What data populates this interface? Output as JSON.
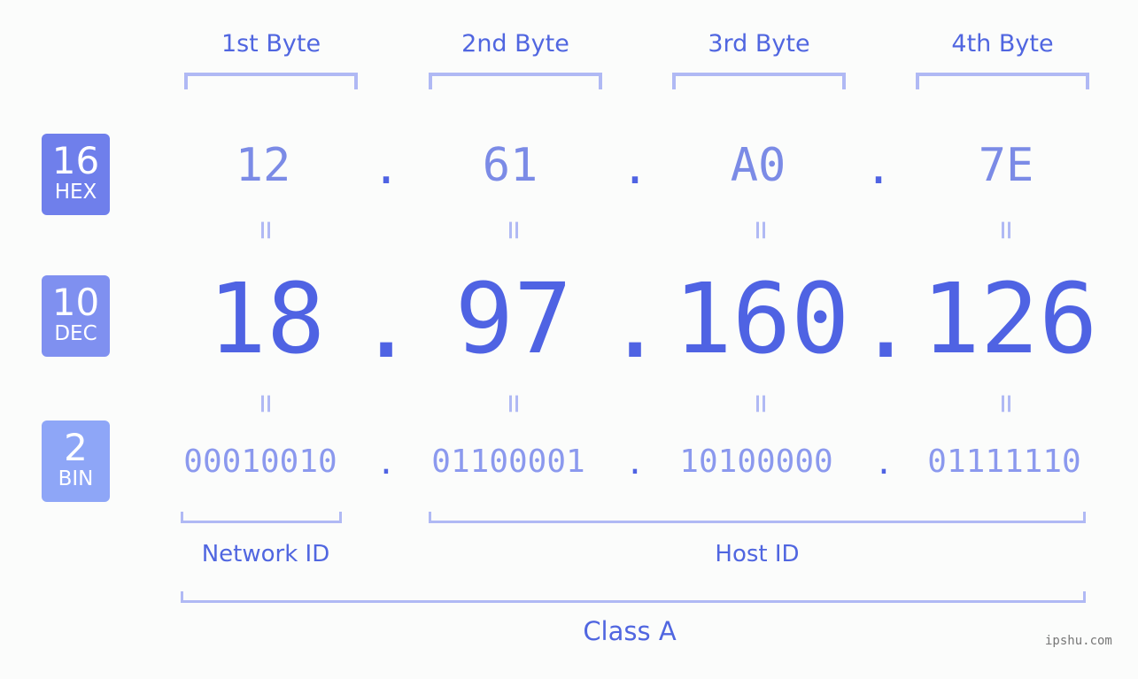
{
  "badges": [
    {
      "base": "16",
      "label": "HEX",
      "color": "#6f7feb"
    },
    {
      "base": "10",
      "label": "DEC",
      "color": "#7f90f0"
    },
    {
      "base": "2",
      "label": "BIN",
      "color": "#8ea6f7"
    }
  ],
  "byte_headers": [
    "1st Byte",
    "2nd Byte",
    "3rd Byte",
    "4th Byte"
  ],
  "hex": [
    "12",
    "61",
    "A0",
    "7E"
  ],
  "dec": [
    "18",
    "97",
    "160",
    "126"
  ],
  "bin": [
    "00010010",
    "01100001",
    "10100000",
    "01111110"
  ],
  "separator": ".",
  "equals": "=",
  "network_label": "Network ID",
  "host_label": "Host ID",
  "class_label": "Class A",
  "watermark": "ipshu.com"
}
